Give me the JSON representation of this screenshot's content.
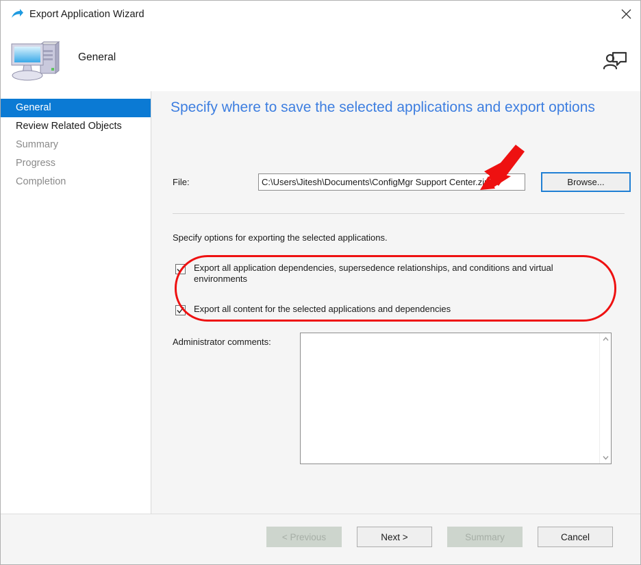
{
  "window": {
    "title": "Export Application Wizard",
    "title_icon": "export-arrow-icon",
    "close_label": "✕"
  },
  "header": {
    "icon": "computer-icon",
    "step_title": "General",
    "feedback_icon": "person-feedback-icon"
  },
  "sidebar": {
    "items": [
      {
        "label": "General",
        "state": "selected"
      },
      {
        "label": "Review Related Objects",
        "state": "visited"
      },
      {
        "label": "Summary",
        "state": "pending"
      },
      {
        "label": "Progress",
        "state": "pending"
      },
      {
        "label": "Completion",
        "state": "pending"
      }
    ]
  },
  "content": {
    "heading": "Specify where to save the selected applications and export options",
    "file": {
      "label": "File:",
      "value": "C:\\Users\\Jitesh\\Documents\\ConfigMgr Support Center.zip",
      "placeholder": "",
      "browse_label": "Browse..."
    },
    "options_caption": "Specify options for exporting the selected applications.",
    "checkboxes": [
      {
        "label": "Export all application dependencies, supersedence relationships, and conditions and virtual environments",
        "checked": true
      },
      {
        "label": "Export all content for the selected applications and dependencies",
        "checked": true
      }
    ],
    "comments": {
      "label": "Administrator comments:",
      "value": "",
      "placeholder": "",
      "scroll_up_icon": "chevron-up-icon",
      "scroll_down_icon": "chevron-down-icon"
    }
  },
  "footer": {
    "buttons": [
      {
        "label": "< Previous",
        "enabled": false
      },
      {
        "label": "Next >",
        "enabled": true
      },
      {
        "label": "Summary",
        "enabled": false
      },
      {
        "label": "Cancel",
        "enabled": true
      }
    ]
  },
  "annotations": {
    "arrow_color": "#ee1111",
    "rect_color": "#ee1111",
    "arrow_icon": "red-pointer-arrow",
    "rect_name": "red-highlight-rectangle"
  },
  "colors": {
    "selection_blue": "#0b7ad4",
    "heading_blue": "#3d7ee0",
    "focus_blue": "#1f7fd4",
    "annotation_red": "#ee1111"
  }
}
